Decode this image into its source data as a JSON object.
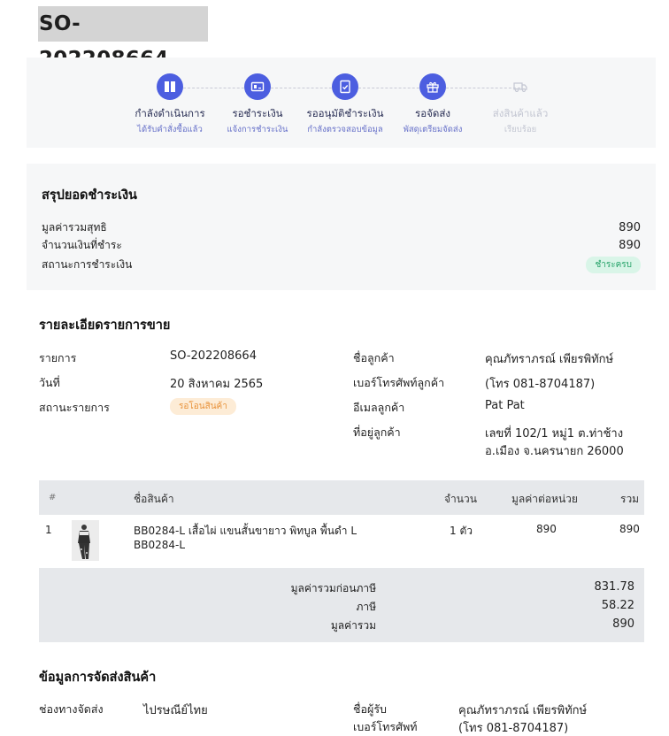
{
  "order": {
    "number": "SO-202208664"
  },
  "steps": [
    {
      "title": "กำลังดำเนินการ",
      "subtitle": "ได้รับคำสั่งซื้อแล้ว",
      "icon": "package-icon",
      "status": "done"
    },
    {
      "title": "รอชำระเงิน",
      "subtitle": "แจ้งการชำระเงิน",
      "icon": "payment-card-icon",
      "status": "done"
    },
    {
      "title": "รออนุมัติชำระเงิน",
      "subtitle": "กำลังตรวจสอบข้อมูล",
      "icon": "document-check-icon",
      "status": "done"
    },
    {
      "title": "รอจัดส่ง",
      "subtitle": "พัสดุเตรียมจัดส่ง",
      "icon": "gift-box-icon",
      "status": "done"
    },
    {
      "title": "ส่งสินค้าแล้ว",
      "subtitle": "เรียบร้อย",
      "icon": "delivery-truck-icon",
      "status": "pending"
    }
  ],
  "payment": {
    "title": "สรุปยอดชำระเงิน",
    "net_total_label": "มูลค่ารวมสุทธิ",
    "net_total": "890",
    "paid_label": "จำนวนเงินที่ชำระ",
    "paid": "890",
    "status_label": "สถานะการชำระเงิน",
    "status": "ชำระครบ"
  },
  "details": {
    "title": "รายละเอียดรายการขาย",
    "item_label": "รายการ",
    "item_value": "SO-202208664",
    "date_label": "วันที่",
    "date_value": "20 สิงหาคม 2565",
    "status_label": "สถานะรายการ",
    "status_value": "รอโอนสินค้า",
    "customer_name_label": "ชื่อลูกค้า",
    "customer_name": "คุณภัทราภรณ์ เพียรพิทักษ์",
    "customer_phone_label": "เบอร์โทรศัพท์ลูกค้า",
    "customer_phone": "(โทร 081-8704187)",
    "customer_email_label": "อีเมลลูกค้า",
    "customer_email": "Pat Pat",
    "customer_address_label": "ที่อยู่ลูกค้า",
    "customer_address_line1": "เลขที่ 102/1 หมู่1 ต.ท่าช้าง",
    "customer_address_line2": "อ.เมือง จ.นครนายก 26000"
  },
  "table": {
    "headers": {
      "index": "#",
      "name": "ชื่อสินค้า",
      "qty": "จำนวน",
      "unit_price": "มูลค่าต่อหน่วย",
      "total": "รวม"
    },
    "rows": [
      {
        "index": "1",
        "name_line1": "BB0284-L เสื้อไผ่ แขนสั้นขายาว พิทบูล พื้นดำ L",
        "name_line2": "BB0284-L",
        "qty": "1 ตัว",
        "unit_price": "890",
        "total": "890"
      }
    ],
    "subtotal_label": "มูลค่ารวมก่อนภาษี",
    "subtotal": "831.78",
    "tax_label": "ภาษี",
    "tax": "58.22",
    "grand_total_label": "มูลค่ารวม",
    "grand_total": "890"
  },
  "shipping": {
    "title": "ข้อมูลการจัดส่งสินค้า",
    "channel_label": "ช่องทางจัดส่ง",
    "channel": "ไปรษณีย์ไทย",
    "recipient_label": "ชื่อผู้รับ",
    "recipient": "คุณภัทราภรณ์ เพียรพิทักษ์",
    "phone_label": "เบอร์โทรศัพท์",
    "phone": "(โทร 081-8704187)"
  },
  "colors": {
    "accent": "#4c5ee0",
    "paid_badge_bg": "#d9f5e8",
    "paid_badge_text": "#27a36a",
    "pending_badge_bg": "#fdecd6",
    "pending_badge_text": "#e8923a"
  }
}
